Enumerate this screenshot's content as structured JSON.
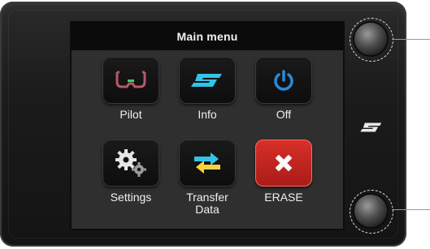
{
  "screen": {
    "title": "Main menu"
  },
  "menu": {
    "items": [
      {
        "label": "Pilot",
        "icon": "steering-wheel-icon"
      },
      {
        "label": "Info",
        "icon": "brand-s-icon"
      },
      {
        "label": "Off",
        "icon": "power-icon"
      },
      {
        "label": "Settings",
        "icon": "gears-icon"
      },
      {
        "label_line1": "Transfer",
        "label_line2": "Data",
        "icon": "transfer-arrows-icon"
      },
      {
        "label": "ERASE",
        "icon": "red-x-icon"
      }
    ]
  },
  "colors": {
    "header_bg": "#0b0b0b",
    "screen_bg": "#2f2f2f",
    "accent_cyan": "#34c3e6",
    "power_blue": "#2a8ad8",
    "erase_red": "#c7221e",
    "pilot_green": "#2ed36a",
    "transfer_yellow": "#f4d33c"
  }
}
